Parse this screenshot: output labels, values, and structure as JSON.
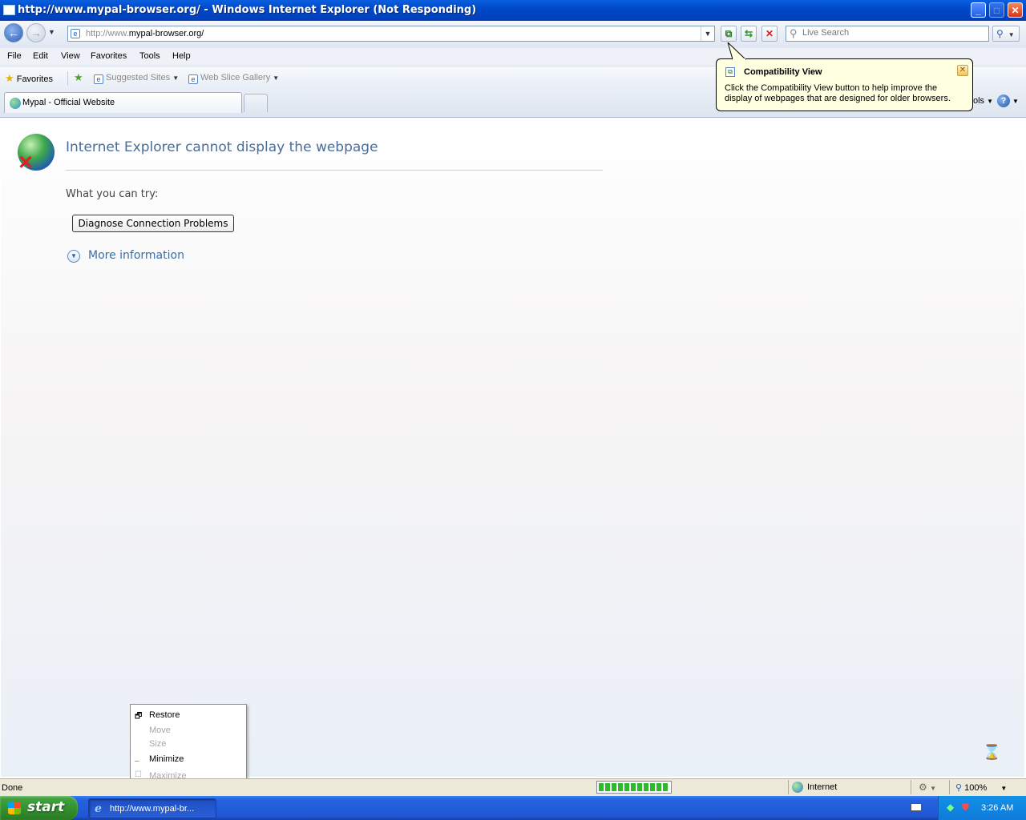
{
  "window": {
    "title": "http://www.mypal-browser.org/ - Windows Internet Explorer (Not Responding)"
  },
  "nav": {
    "url_prefix": "http://www.",
    "url_main": "mypal-browser.org/",
    "search_placeholder": "Live Search"
  },
  "menu": [
    "File",
    "Edit",
    "View",
    "Favorites",
    "Tools",
    "Help"
  ],
  "favorites": {
    "label": "Favorites",
    "suggested": "Suggested Sites",
    "webslice": "Web Slice Gallery"
  },
  "tabs": {
    "active_title": "Mypal - Official Website",
    "tools_fragment": "ols"
  },
  "balloon": {
    "title": "Compatibility View",
    "body": "Click the Compatibility View button to help improve the display of webpages that are designed for older browsers."
  },
  "content": {
    "error_title": "Internet Explorer cannot display the webpage",
    "try_label": "What you can try:",
    "diagnose_button": "Diagnose Connection Problems",
    "more_info": "More information"
  },
  "context_menu": {
    "restore": "Restore",
    "move": "Move",
    "size": "Size",
    "minimize": "Minimize",
    "maximize": "Maximize"
  },
  "status": {
    "text": "Done",
    "progress_fraction": 1.0,
    "zone": "Internet",
    "zoom": "100%"
  },
  "taskbar": {
    "start_label": "start",
    "item_title": "http://www.mypal-br...",
    "clock": "3:26 AM"
  },
  "colors": {
    "titlebar": "#0049c9",
    "error_title": "#4a6d99",
    "link": "#3b6ea5",
    "balloon_bg": "#ffffe1",
    "taskbar": "#2156d4",
    "start": "#34922f"
  }
}
